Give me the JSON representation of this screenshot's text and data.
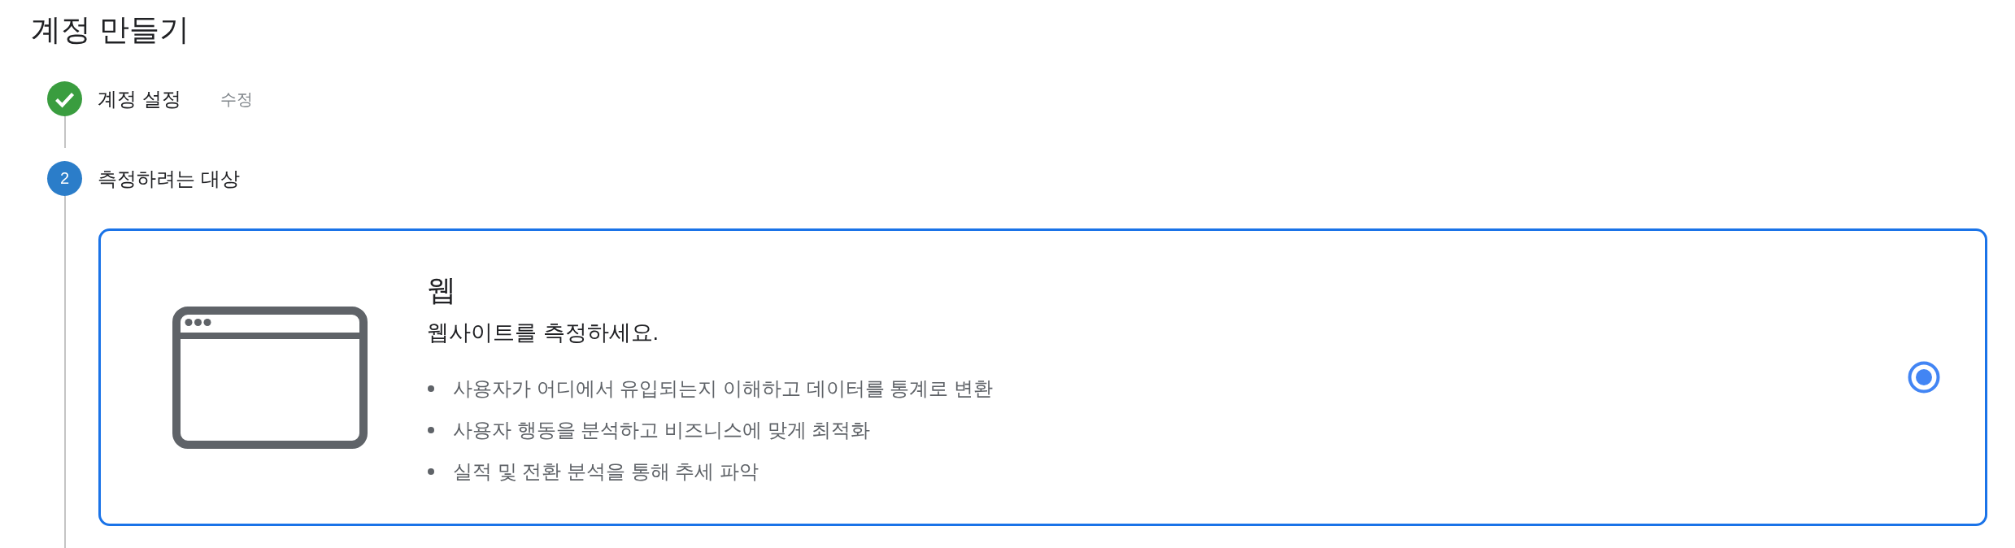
{
  "page": {
    "title": "계정 만들기"
  },
  "steps": [
    {
      "label": "계정 설정",
      "completed": true,
      "action": "수정"
    },
    {
      "number": "2",
      "label": "측정하려는 대상",
      "completed": false
    }
  ],
  "options": [
    {
      "kind": "web",
      "title": "웹",
      "subtitle": "웹사이트를 측정하세요.",
      "bullets": [
        "사용자가 어디에서 유입되는지 이해하고 데이터를 통계로 변환",
        "사용자 행동을 분석하고 비즈니스에 맞게 최적화",
        "실적 및 전환 분석을 통해 추세 파악"
      ],
      "selected": true
    }
  ]
}
